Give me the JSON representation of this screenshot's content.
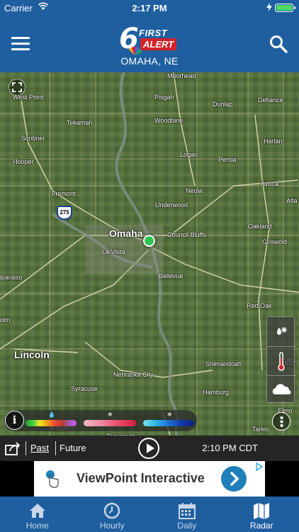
{
  "status_bar": {
    "carrier": "Carrier",
    "time": "2:17 PM"
  },
  "header": {
    "logo_number": "6",
    "logo_first": "FIRST",
    "logo_alert": "ALERT",
    "location": "OMAHA, NE"
  },
  "map": {
    "towns": [
      {
        "name": "Moorhead"
      },
      {
        "name": "West Point"
      },
      {
        "name": "Pisgah"
      },
      {
        "name": "Defiance"
      },
      {
        "name": "Dunlap"
      },
      {
        "name": "Tekamah"
      },
      {
        "name": "Woodbine"
      },
      {
        "name": "Scribner"
      },
      {
        "name": "Harlan"
      },
      {
        "name": "Hooper"
      },
      {
        "name": "Logan"
      },
      {
        "name": "Persia"
      },
      {
        "name": "Neola"
      },
      {
        "name": "Avoca"
      },
      {
        "name": "Fremont"
      },
      {
        "name": "Atla"
      },
      {
        "name": "Underwood"
      },
      {
        "name": "Omaha"
      },
      {
        "name": "Council Bluffs"
      },
      {
        "name": "Oakland"
      },
      {
        "name": "La Vista"
      },
      {
        "name": "Griswold"
      },
      {
        "name": "lparaiso"
      },
      {
        "name": "Bellevue"
      },
      {
        "name": "Red Oak"
      },
      {
        "name": "olm"
      },
      {
        "name": "Lincoln"
      },
      {
        "name": "Shenandoah"
      },
      {
        "name": "Nebraska City"
      },
      {
        "name": "Syracuse"
      },
      {
        "name": "Hamburg"
      },
      {
        "name": "Tabor"
      },
      {
        "name": "Tarkio"
      },
      {
        "name": "Auburn"
      },
      {
        "name": "Tecumseh"
      },
      {
        "name": "Elmo"
      },
      {
        "name": "Ealr"
      }
    ],
    "highway_shield": "275"
  },
  "legend": {
    "info_label": "i"
  },
  "playback": {
    "past_label": "Past",
    "future_label": "Future",
    "timestamp": "2:10 PM CDT"
  },
  "ad": {
    "text": "ViewPoint Interactive"
  },
  "tabs": [
    {
      "label": "Home",
      "icon": "home-icon"
    },
    {
      "label": "Hourly",
      "icon": "clock-icon"
    },
    {
      "label": "Daily",
      "icon": "calendar-icon"
    },
    {
      "label": "Radar",
      "icon": "map-icon"
    }
  ],
  "colors": {
    "header": "#1f5fa0",
    "pin": "#2fc452",
    "alert_red": "#d2232a",
    "ad_arrow": "#1f7fb8"
  }
}
